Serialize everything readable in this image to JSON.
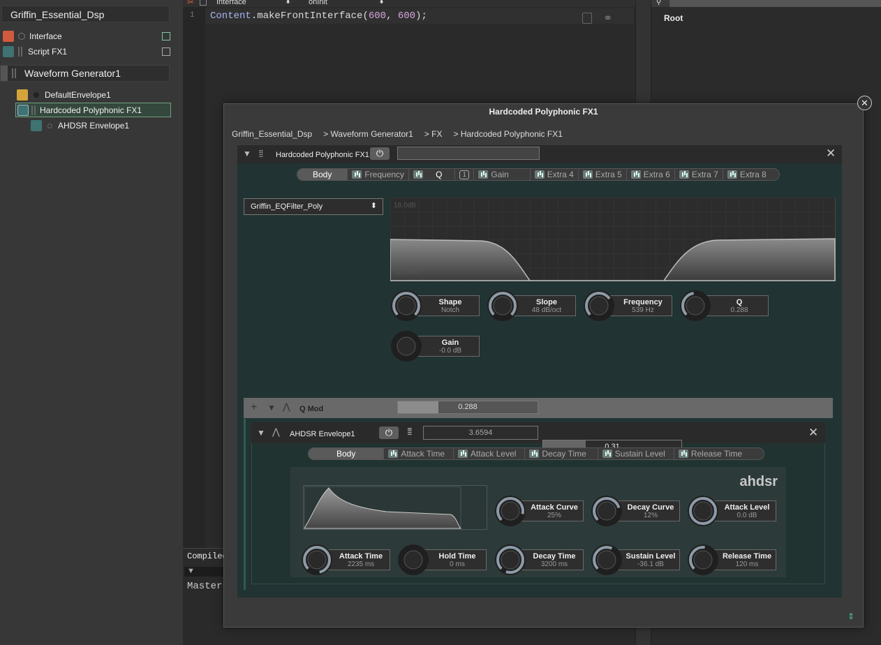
{
  "tree": {
    "root": "Griffin_Essential_Dsp",
    "items": [
      {
        "label": "Interface",
        "color": "#d05a3e"
      },
      {
        "label": "Script FX1",
        "color": "#3f7272"
      },
      {
        "label": "Waveform Generator1",
        "color": "#555555"
      },
      {
        "label": "DefaultEnvelope1",
        "color": "#d4a33b"
      },
      {
        "label": "Hardcoded Polyphonic FX1",
        "color": "#3f7272"
      },
      {
        "label": "AHDSR Envelope1",
        "color": "#3f7272"
      }
    ]
  },
  "editor": {
    "dropdown1": "Interface",
    "dropdown2": "onInit",
    "line_number": "1",
    "code_keyword": "Content",
    "code_rest": ".makeFrontInterface(",
    "code_num1": "600",
    "code_sep": ", ",
    "code_num2": "600",
    "code_end": ");",
    "compiled_label": "Compiled",
    "master_label": "Master"
  },
  "root_panel": {
    "title": "Root"
  },
  "popup": {
    "title": "Hardcoded Polyphonic FX1",
    "breadcrumb": [
      "Griffin_Essential_Dsp",
      "Waveform Generator1",
      "FX",
      "Hardcoded Polyphonic FX1"
    ],
    "module_title": "Hardcoded Polyphonic FX1",
    "tabs": [
      "Body",
      "Frequency",
      "Q",
      "Gain",
      "Extra 4",
      "Extra 5",
      "Extra 6",
      "Extra 7",
      "Extra 8"
    ],
    "filter_select": "Griffin_EQFilter_Poly",
    "graph_top": "18.0dB",
    "graph_bottom": "-18.0dB",
    "knobs": [
      {
        "name": "Shape",
        "value": "Notch"
      },
      {
        "name": "Slope",
        "value": "48 dB/oct"
      },
      {
        "name": "Frequency",
        "value": "539 Hz"
      },
      {
        "name": "Q",
        "value": "0.288"
      },
      {
        "name": "Gain",
        "value": "-0.0 dB"
      }
    ],
    "qmod": {
      "label": "Q Mod",
      "value": "0.288",
      "fill": 0.288
    },
    "env": {
      "title": "AHDSR Envelope1",
      "value1": "3.6594",
      "value2": "0.31",
      "value2_fill": 0.31,
      "tabs": [
        "Body",
        "Attack Time",
        "Attack Level",
        "Decay Time",
        "Sustain Level",
        "Release Time"
      ],
      "brand": "ahdsr",
      "knobs_top": [
        {
          "name": "Attack Curve",
          "value": "25%"
        },
        {
          "name": "Decay Curve",
          "value": "12%"
        },
        {
          "name": "Attack Level",
          "value": "0.0 dB"
        }
      ],
      "knobs_bottom": [
        {
          "name": "Attack Time",
          "value": "2235 ms"
        },
        {
          "name": "Hold Time",
          "value": "0 ms"
        },
        {
          "name": "Decay Time",
          "value": "3200 ms"
        },
        {
          "name": "Sustain Level",
          "value": "-36.1 dB"
        },
        {
          "name": "Release Time",
          "value": "120 ms"
        }
      ]
    }
  }
}
